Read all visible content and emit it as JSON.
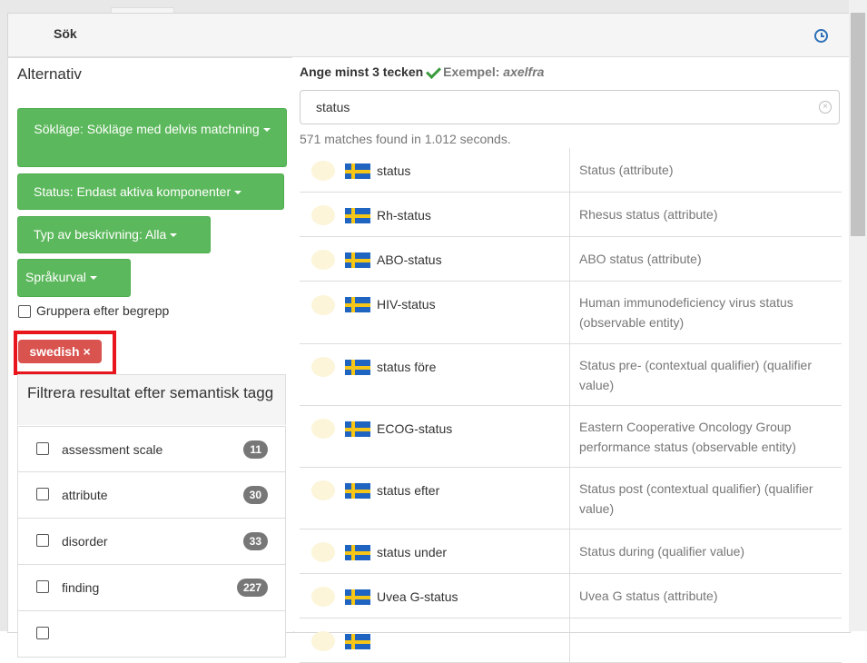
{
  "panel": {
    "title": "Sök",
    "history_icon": "clock-icon"
  },
  "sidebar": {
    "title": "Alternativ",
    "search_mode_label": "Sökläge: Sökläge med delvis matchning",
    "status_label": "Status: Endast aktiva komponenter",
    "desc_type_label": "Typ av beskrivning: Alla",
    "language_label": "Språkurval",
    "group_label": "Gruppera efter begrepp",
    "active_filter_tag": "swedish ×",
    "semantic_filter_title": "Filtrera resultat efter semantisk tagg",
    "semantic_tags": [
      {
        "label": "assessment scale",
        "count": "11"
      },
      {
        "label": "attribute",
        "count": "30"
      },
      {
        "label": "disorder",
        "count": "33"
      },
      {
        "label": "finding",
        "count": "227"
      },
      {
        "label": "",
        "count": ""
      }
    ]
  },
  "main": {
    "hint_bold": "Ange minst 3 tecken",
    "hint_example_label": "Exempel:",
    "hint_example_value": "axelfra",
    "search_value": "status",
    "match_info": "571 matches found in 1.012 seconds.",
    "results": [
      {
        "term": "status",
        "description": "Status (attribute)"
      },
      {
        "term": "Rh-status",
        "description": "Rhesus status (attribute)"
      },
      {
        "term": "ABO-status",
        "description": "ABO status (attribute)"
      },
      {
        "term": "HIV-status",
        "description": "Human immunodeficiency virus status (observable entity)"
      },
      {
        "term": "status före",
        "description": "Status pre- (contextual qualifier) (qualifier value)"
      },
      {
        "term": "ECOG-status",
        "description": "Eastern Cooperative Oncology Group performance status (observable entity)"
      },
      {
        "term": "status efter",
        "description": "Status post (contextual qualifier) (qualifier value)"
      },
      {
        "term": "status under",
        "description": "Status during (qualifier value)"
      },
      {
        "term": "Uvea G-status",
        "description": "Uvea G status (attribute)"
      },
      {
        "term": "",
        "description": ""
      }
    ]
  },
  "colors": {
    "green": "#5cb85c",
    "red_tag": "#d9534f",
    "highlight_frame": "#e8161c",
    "flag_blue": "#1f64c0",
    "flag_yellow": "#f5c518"
  }
}
